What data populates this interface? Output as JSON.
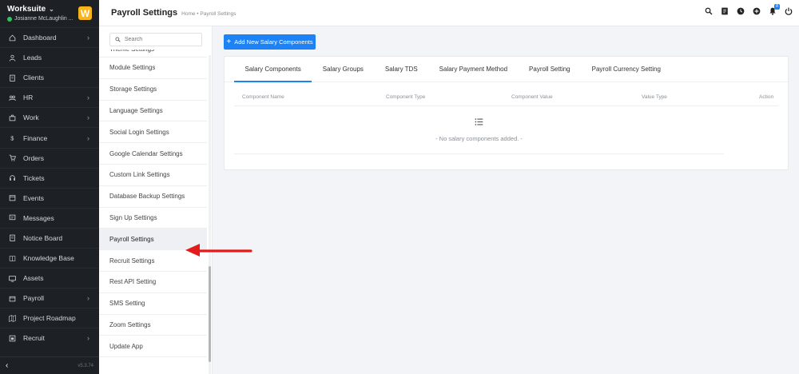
{
  "brand": {
    "name": "Worksuite",
    "user": "Josianne McLaughlin ...",
    "logo_letter": "W"
  },
  "sidebar": {
    "items": [
      {
        "label": "Dashboard",
        "icon": "house-icon",
        "has_children": true
      },
      {
        "label": "Leads",
        "icon": "person-icon",
        "has_children": false
      },
      {
        "label": "Clients",
        "icon": "building-icon",
        "has_children": false
      },
      {
        "label": "HR",
        "icon": "people-icon",
        "has_children": true
      },
      {
        "label": "Work",
        "icon": "briefcase-icon",
        "has_children": true
      },
      {
        "label": "Finance",
        "icon": "dollar-icon",
        "has_children": true
      },
      {
        "label": "Orders",
        "icon": "cart-icon",
        "has_children": false
      },
      {
        "label": "Tickets",
        "icon": "headset-icon",
        "has_children": false
      },
      {
        "label": "Events",
        "icon": "calendar-icon",
        "has_children": false
      },
      {
        "label": "Messages",
        "icon": "chat-icon",
        "has_children": false
      },
      {
        "label": "Notice Board",
        "icon": "clipboard-icon",
        "has_children": false
      },
      {
        "label": "Knowledge Base",
        "icon": "book-icon",
        "has_children": false
      },
      {
        "label": "Assets",
        "icon": "monitor-icon",
        "has_children": false
      },
      {
        "label": "Payroll",
        "icon": "wallet-icon",
        "has_children": true
      },
      {
        "label": "Project Roadmap",
        "icon": "map-icon",
        "has_children": false
      },
      {
        "label": "Recruit",
        "icon": "id-card-icon",
        "has_children": true
      }
    ],
    "version": "v5.3.74"
  },
  "header": {
    "title": "Payroll Settings",
    "breadcrumb": "Home • Payroll Settings"
  },
  "settings_menu": {
    "search_placeholder": "Search",
    "items": [
      "Theme Settings",
      "Module Settings",
      "Storage Settings",
      "Language Settings",
      "Social Login Settings",
      "Google Calendar Settings",
      "Custom Link Settings",
      "Database Backup Settings",
      "Sign Up Settings",
      "Payroll Settings",
      "Recruit Settings",
      "Rest API Setting",
      "SMS Setting",
      "Zoom Settings",
      "Update App"
    ],
    "active_index": 9
  },
  "main": {
    "add_button": "Add New Salary Components",
    "tabs": [
      "Salary Components",
      "Salary Groups",
      "Salary TDS",
      "Salary Payment Method",
      "Payroll Setting",
      "Payroll Currency Setting"
    ],
    "active_tab": 0,
    "columns": [
      "Component Name",
      "Component Type",
      "Component Value",
      "Value Type",
      "Action"
    ],
    "empty_message": "- No salary components added. -"
  },
  "notifications": {
    "count": "8"
  },
  "colors": {
    "primary": "#1d82f5",
    "sidebar_bg": "#1d2126",
    "logo": "#f8b418",
    "arrow": "#e31b1b"
  }
}
